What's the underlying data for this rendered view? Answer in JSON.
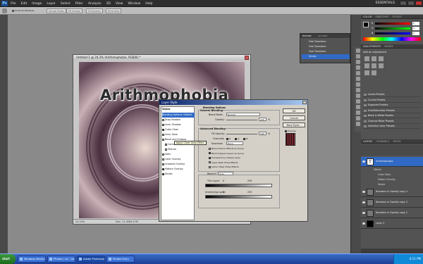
{
  "app": {
    "logo_text": "Ps",
    "menu": [
      "File",
      "Edit",
      "Image",
      "Layer",
      "Select",
      "Filter",
      "Analysis",
      "3D",
      "View",
      "Window",
      "Help"
    ],
    "workspace": "ESSENTIALS",
    "options": {
      "scroll_all": "Scroll All Windows",
      "b1": "Actual Pixels",
      "b2": "Fit Screen",
      "b3": "Fill Screen",
      "b4": "Print Size"
    }
  },
  "document": {
    "title": "Untitled-1 @ 24.2% (Arithmophobia, RGB/8) *",
    "artwork_text": "Arithmophobia",
    "zoom": "24.24%",
    "doc_info": "Doc: 11.4M/6.47M"
  },
  "history": {
    "tabs": [
      "HISTORY",
      "ACTIONS"
    ],
    "items": [
      "Free Transform",
      "Free Transform",
      "Free Transform",
      "Stroke"
    ],
    "selected_index": 3
  },
  "layer_style": {
    "title": "Layer Style",
    "styles_header": "Styles",
    "styles": [
      {
        "label": "Blending Options: Default",
        "checked": false,
        "selected": true,
        "has_box": false
      },
      {
        "label": "Drop Shadow",
        "checked": false
      },
      {
        "label": "Inner Shadow",
        "checked": false
      },
      {
        "label": "Outer Glow",
        "checked": true
      },
      {
        "label": "Inner Glow",
        "checked": false
      },
      {
        "label": "Bevel and Emboss",
        "checked": false
      },
      {
        "label": "Contour",
        "checked": false,
        "indent": true
      },
      {
        "label": "Texture",
        "checked": false,
        "indent": true
      },
      {
        "label": "Satin",
        "checked": false
      },
      {
        "label": "Color Overlay",
        "checked": false
      },
      {
        "label": "Gradient Overlay",
        "checked": false
      },
      {
        "label": "Pattern Overlay",
        "checked": true
      },
      {
        "label": "Stroke",
        "checked": true
      }
    ],
    "tooltip": "Apply Outer Glow Effect",
    "blending": {
      "section": "Blending Options",
      "general": "General Blending",
      "blend_mode_label": "Blend Mode:",
      "blend_mode": "Normal",
      "opacity_label": "Opacity:",
      "opacity": "100",
      "advanced": "Advanced Blending",
      "fill_label": "Fill Opacity:",
      "fill": "100",
      "channels_label": "Channels:",
      "channels": [
        "R",
        "G",
        "B"
      ],
      "knockout_label": "Knockout:",
      "knockout": "None",
      "options": [
        {
          "label": "Blend Interior Effects as Group",
          "checked": false
        },
        {
          "label": "Blend Clipped Layers as Group",
          "checked": true
        },
        {
          "label": "Transparency Shapes Layer",
          "checked": true
        },
        {
          "label": "Layer Mask Hides Effects",
          "checked": false
        },
        {
          "label": "Vector Mask Hides Effects",
          "checked": false
        }
      ],
      "blend_if_label": "Blend If:",
      "blend_if": "Gray",
      "this_layer_label": "This Layer:",
      "this_layer_min": "0",
      "this_layer_max": "255",
      "underlying_label": "Underlying Layer:",
      "underlying_min": "0",
      "underlying_max": "255",
      "percent": "%"
    },
    "buttons": {
      "ok": "OK",
      "cancel": "Cancel",
      "new_style": "New Style...",
      "preview": "Preview"
    }
  },
  "color_panel": {
    "tabs": [
      "COLOR",
      "SWATCHES",
      "STYLES"
    ],
    "channels": [
      "R",
      "G",
      "B"
    ],
    "values": [
      "0",
      "0",
      "0"
    ]
  },
  "adjustments": {
    "tabs": [
      "ADJUSTMENTS",
      "MASKS"
    ],
    "title": "Add an adjustment",
    "items": [
      "Levels Presets",
      "Curves Presets",
      "Exposure Presets",
      "Hue/Saturation Presets",
      "Black & White Presets",
      "Channel Mixer Presets",
      "Selective Color Presets"
    ]
  },
  "layers": {
    "tabs": [
      "LAYERS",
      "CHANNELS",
      "PATHS"
    ],
    "items": [
      {
        "name": "Arithmophobia",
        "selected": true,
        "fx": true
      },
      {
        "name": "Numbers in Opacity copy 4"
      },
      {
        "name": "Numbers in Opacity copy 3"
      },
      {
        "name": "Numbers in Opacity copy 2"
      },
      {
        "name": "Layer 2"
      }
    ],
    "effects": [
      "Effects",
      "Outer Glow",
      "Pattern Overlay",
      "Stroke"
    ]
  },
  "taskbar": {
    "start": "start",
    "items": [
      "Windows Media Player",
      "Photos | Lol - Go A Fl...",
      "Adobe Photoshop C...",
      "Photos Entry"
    ],
    "active_index": 2,
    "clock": "6:11 PM"
  },
  "colors": {
    "accent": "#316ac5",
    "taskbar": "#245edb",
    "panel": "#535353",
    "canvas": "#8a8a8a"
  }
}
